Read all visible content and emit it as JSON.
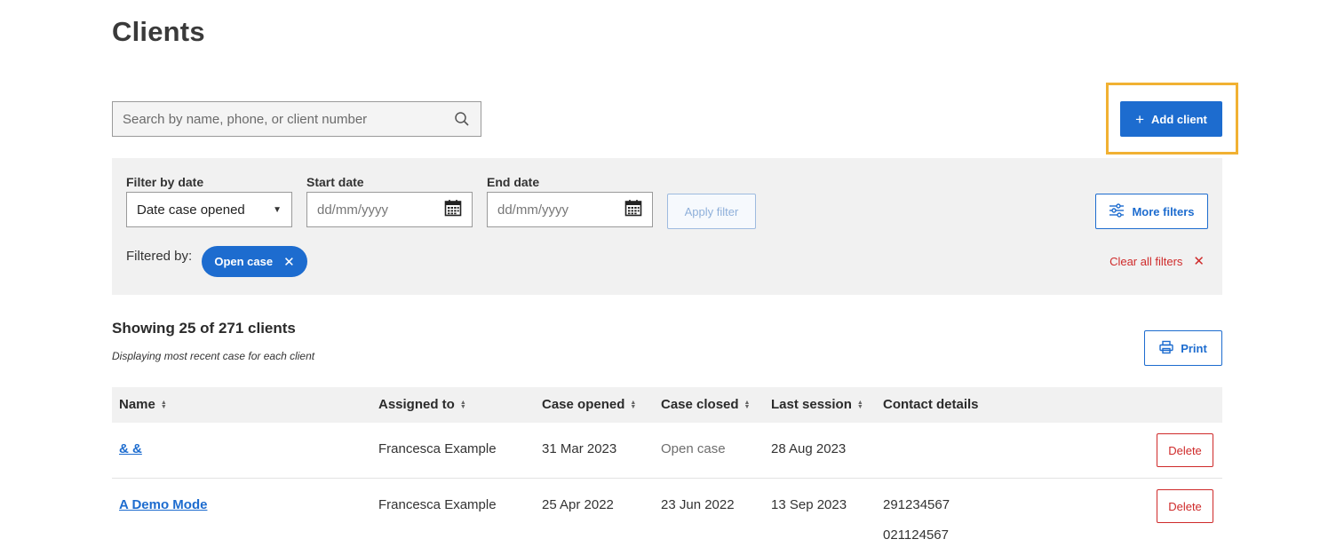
{
  "page": {
    "title": "Clients"
  },
  "search": {
    "placeholder": "Search by name, phone, or client number",
    "icon": "search-icon"
  },
  "actions": {
    "add_client_label": "Add client",
    "add_icon": "plus-icon"
  },
  "filters": {
    "filter_by_date_label": "Filter by date",
    "filter_by_date_value": "Date case opened",
    "start_date_label": "Start date",
    "start_date_placeholder": "dd/mm/yyyy",
    "end_date_label": "End date",
    "end_date_placeholder": "dd/mm/yyyy",
    "apply_label": "Apply filter",
    "more_filters_label": "More filters",
    "filtered_by_label": "Filtered by:",
    "active_chip": "Open case",
    "clear_all_label": "Clear all filters"
  },
  "results": {
    "showing": "Showing 25 of 271 clients",
    "subtext": "Displaying most recent case for each client",
    "print_label": "Print"
  },
  "table": {
    "columns": [
      "Name",
      "Assigned to",
      "Case opened",
      "Case closed",
      "Last session",
      "Contact details"
    ],
    "rows": [
      {
        "name": "& &",
        "assigned": "Francesca Example",
        "opened": "31 Mar 2023",
        "closed": "Open case",
        "last": "28 Aug 2023",
        "contacts": [],
        "delete_label": "Delete"
      },
      {
        "name": "A Demo Mode",
        "assigned": "Francesca Example",
        "opened": "25 Apr 2022",
        "closed": "23 Jun 2022",
        "last": "13 Sep 2023",
        "contacts": [
          "291234567",
          "021124567"
        ],
        "delete_label": "Delete"
      }
    ]
  },
  "colors": {
    "primary": "#1d6ccf",
    "danger": "#cf2a2a",
    "highlight": "#f1b132",
    "panel": "#f1f1f1"
  }
}
